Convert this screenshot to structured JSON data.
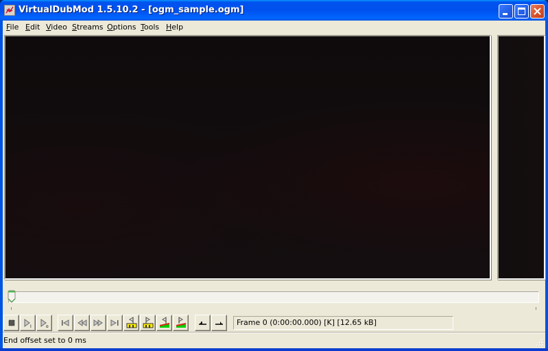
{
  "window": {
    "title": "VirtualDubMod 1.5.10.2 - [ogm_sample.ogm]",
    "app_icon": "virtualdub-icon",
    "controls": {
      "minimize": "minimize-icon",
      "maximize": "maximize-icon",
      "close": "close-icon"
    }
  },
  "menu": {
    "items": [
      {
        "label": "File",
        "accel": "F",
        "rest": "ile"
      },
      {
        "label": "Edit",
        "accel": "E",
        "rest": "dit"
      },
      {
        "label": "Video",
        "accel": "V",
        "rest": "ideo"
      },
      {
        "label": "Streams",
        "accel": "S",
        "rest": "treams"
      },
      {
        "label": "Options",
        "accel": "O",
        "rest": "ptions"
      },
      {
        "label": "Tools",
        "accel": "T",
        "rest": "ools"
      },
      {
        "label": "Help",
        "accel": "H",
        "rest": "elp"
      }
    ]
  },
  "panes": {
    "input": "Input video pane",
    "output": "Output video pane"
  },
  "timeline": {
    "position_fraction": 0.0
  },
  "toolbar": {
    "buttons": [
      {
        "name": "stop-button",
        "icon": "stop-icon",
        "tooltip": "Stop"
      },
      {
        "name": "play-input-button",
        "icon": "play-input-icon",
        "tooltip": "Play input"
      },
      {
        "name": "play-output-button",
        "icon": "play-output-icon",
        "tooltip": "Play output"
      },
      {
        "name": "go-start-button",
        "icon": "go-to-start-icon",
        "tooltip": "Go to start"
      },
      {
        "name": "step-back-button",
        "icon": "rewind-icon",
        "tooltip": "Previous frame"
      },
      {
        "name": "step-forward-button",
        "icon": "fast-forward-icon",
        "tooltip": "Next frame"
      },
      {
        "name": "go-end-button",
        "icon": "go-to-end-icon",
        "tooltip": "Go to end"
      },
      {
        "name": "prev-keyframe-button",
        "icon": "prev-keyframe-icon",
        "tooltip": "Previous keyframe"
      },
      {
        "name": "next-keyframe-button",
        "icon": "next-keyframe-icon",
        "tooltip": "Next keyframe"
      },
      {
        "name": "prev-scene-button",
        "icon": "prev-scene-icon",
        "tooltip": "Previous scene"
      },
      {
        "name": "next-scene-button",
        "icon": "next-scene-icon",
        "tooltip": "Next scene"
      },
      {
        "name": "mark-in-button",
        "icon": "mark-in-icon",
        "tooltip": "Mark in"
      },
      {
        "name": "mark-out-button",
        "icon": "mark-out-icon",
        "tooltip": "Mark out"
      }
    ],
    "frame_info": "Frame 0 (0:00:00.000) [K] [12.65 kB]"
  },
  "status": {
    "text": "End offset set to 0 ms"
  },
  "colors": {
    "titlebar": "#0054e3",
    "face": "#ece9d8",
    "video_bg": "#100c0d",
    "close_btn": "#d9542c"
  }
}
